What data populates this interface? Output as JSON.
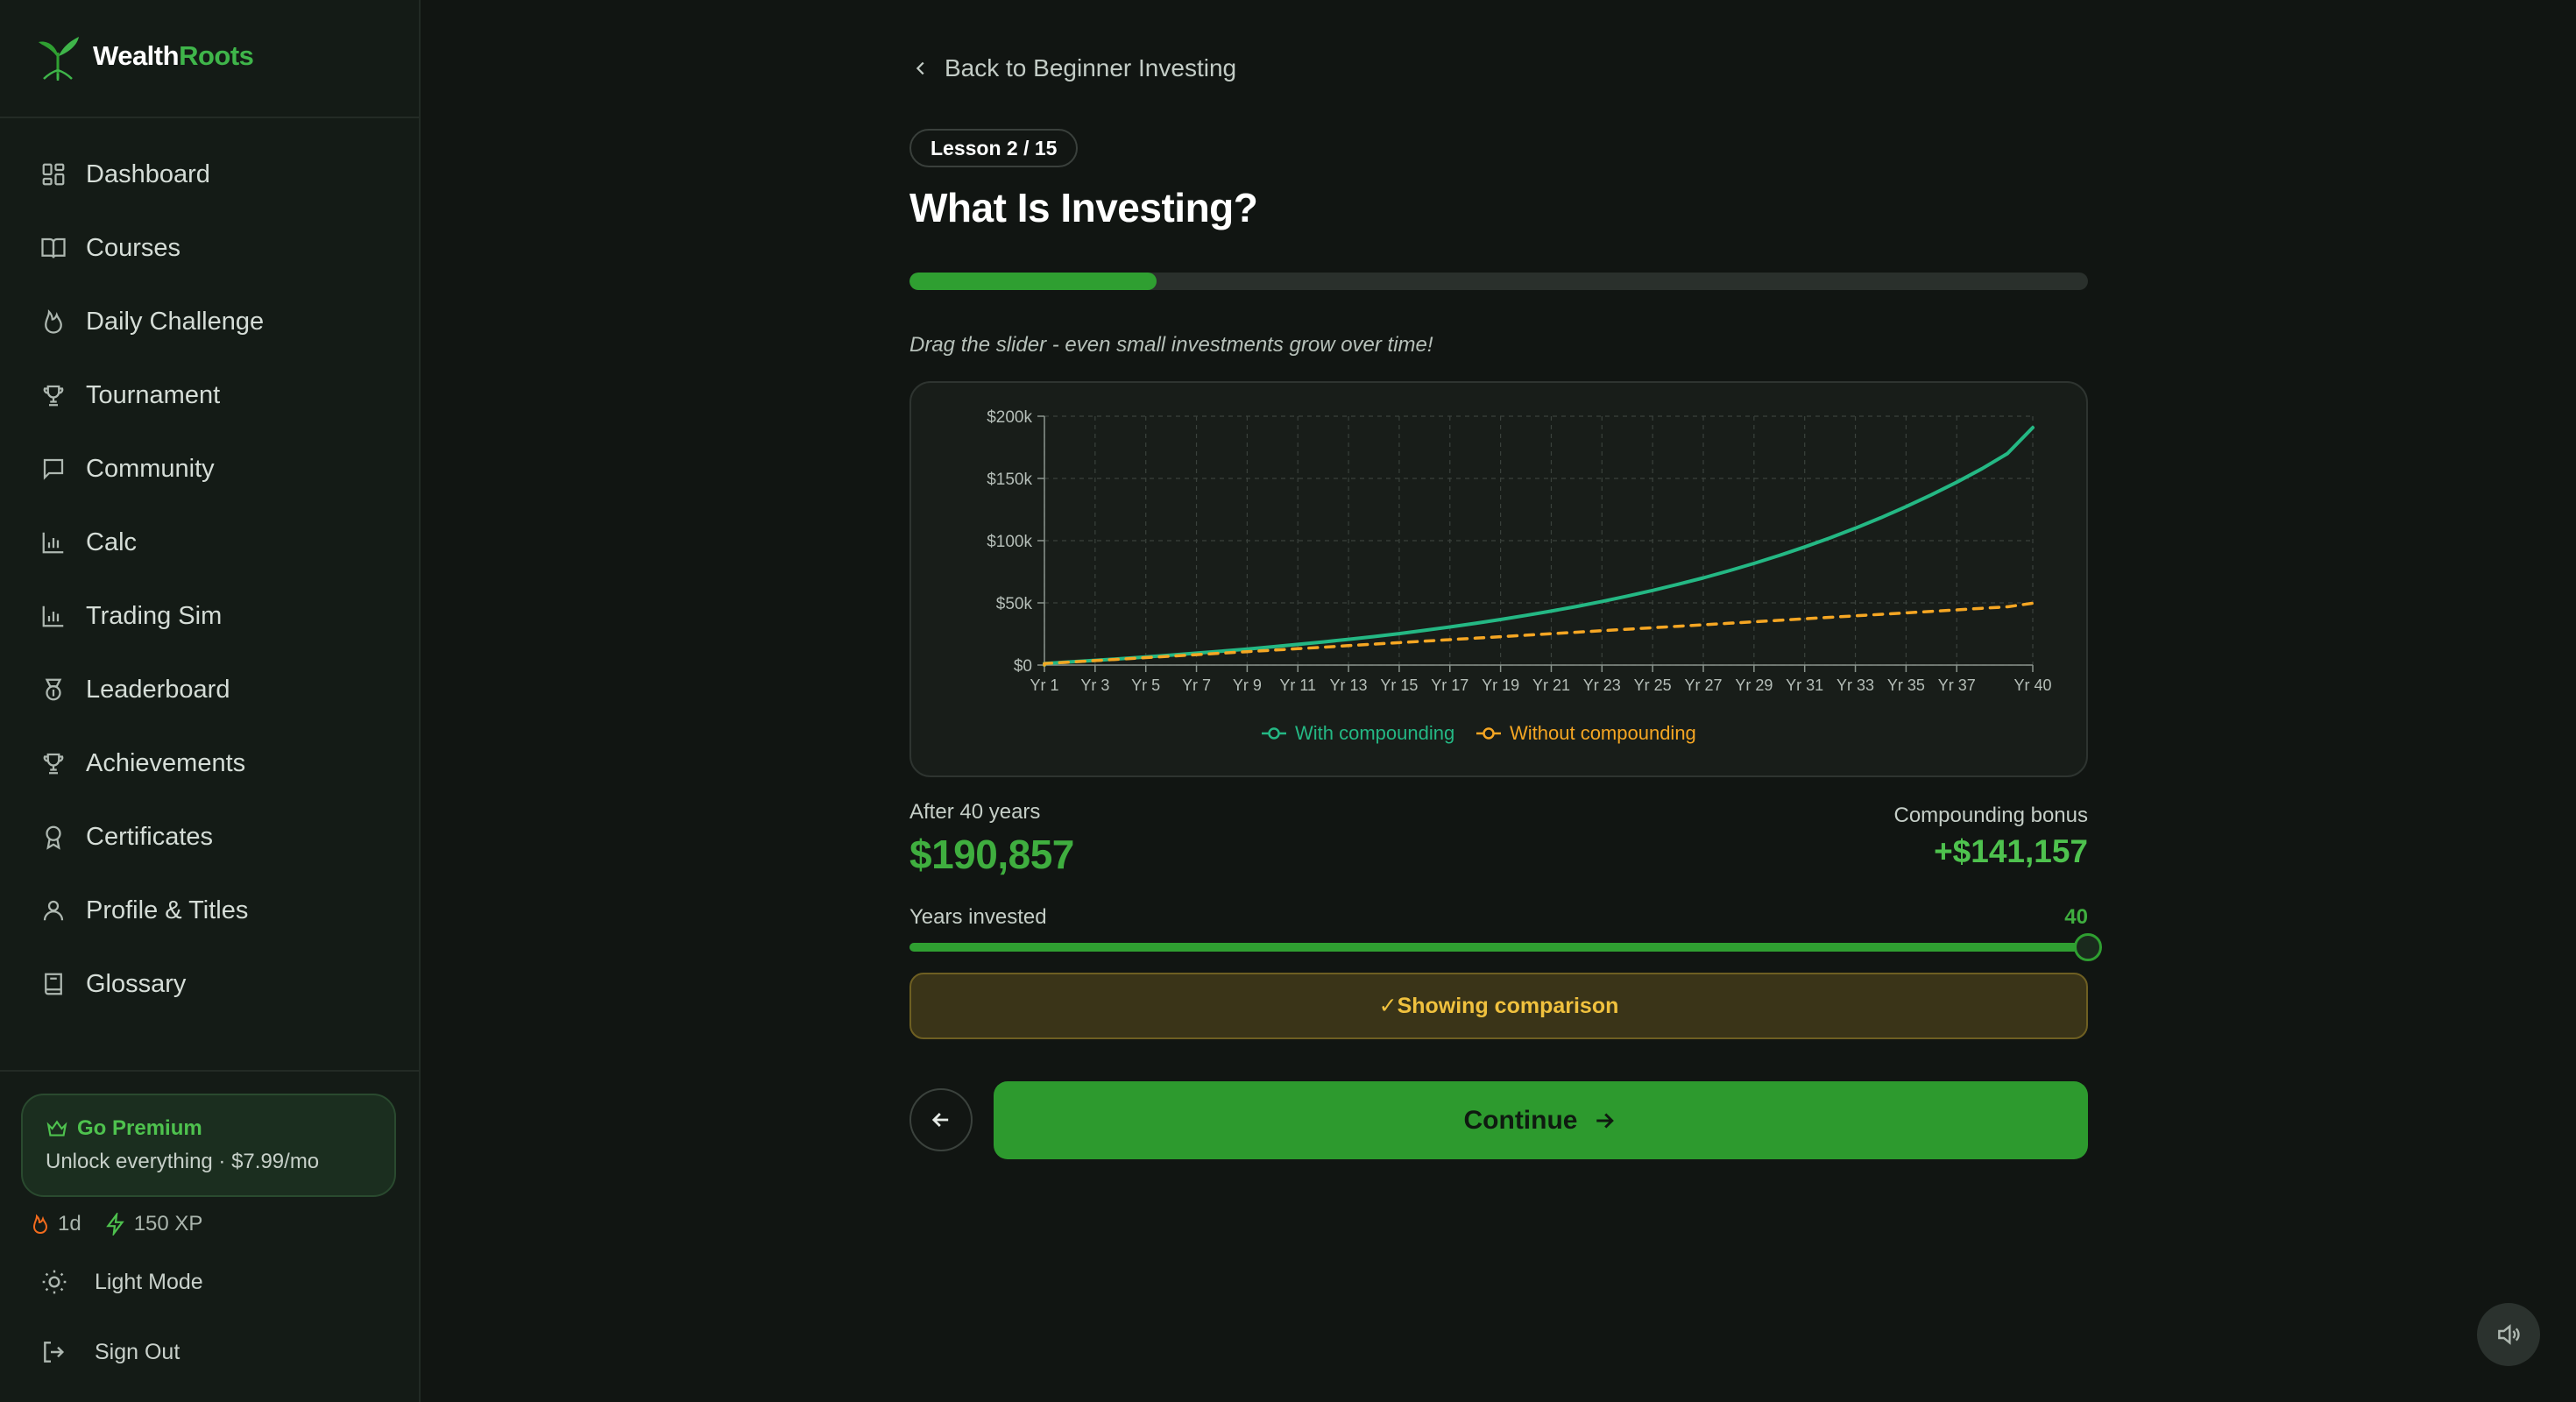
{
  "brand": {
    "name_part1": "Wealth",
    "name_part2": "Roots",
    "logo_icon": "sprout-icon"
  },
  "sidebar": {
    "items": [
      {
        "label": "Dashboard",
        "icon": "dashboard-grid-icon"
      },
      {
        "label": "Courses",
        "icon": "book-open-icon"
      },
      {
        "label": "Daily Challenge",
        "icon": "flame-icon"
      },
      {
        "label": "Tournament",
        "icon": "trophy-icon"
      },
      {
        "label": "Community",
        "icon": "message-square-icon"
      },
      {
        "label": "Calc",
        "icon": "bar-chart-icon"
      },
      {
        "label": "Trading Sim",
        "icon": "bar-chart-icon"
      },
      {
        "label": "Leaderboard",
        "icon": "medal-icon"
      },
      {
        "label": "Achievements",
        "icon": "trophy-icon"
      },
      {
        "label": "Certificates",
        "icon": "award-icon"
      },
      {
        "label": "Profile & Titles",
        "icon": "user-icon"
      },
      {
        "label": "Glossary",
        "icon": "book-icon"
      }
    ],
    "premium": {
      "title": "Go Premium",
      "subtitle": "Unlock everything · $7.99/mo"
    },
    "stats": {
      "streak": "1d",
      "xp": "150 XP"
    },
    "light_mode": "Light Mode",
    "sign_out": "Sign Out"
  },
  "lesson": {
    "back_label": "Back to Beginner Investing",
    "badge": "Lesson 2 / 15",
    "title": "What Is Investing?",
    "progress": 0.21,
    "hint": "Drag the slider - even small investments grow over time!"
  },
  "results": {
    "after_label": "After 40 years",
    "after_value": "$190,857",
    "bonus_label": "Compounding bonus",
    "bonus_value": "+$141,157",
    "years_label": "Years invested",
    "years_value": "40",
    "years_fraction": 1.0
  },
  "comparison_button": "✓Showing comparison",
  "continue_label": "Continue",
  "colors": {
    "accent_green": "#2d9a2e",
    "compounding_line": "#24b884",
    "no_compounding_line": "#f5a623",
    "comparison_gold": "#f0c13e"
  },
  "chart_data": {
    "type": "line",
    "x": [
      1,
      2,
      3,
      4,
      5,
      6,
      7,
      8,
      9,
      10,
      11,
      12,
      13,
      14,
      15,
      16,
      17,
      18,
      19,
      20,
      21,
      22,
      23,
      24,
      25,
      26,
      27,
      28,
      29,
      30,
      31,
      32,
      33,
      34,
      35,
      36,
      37,
      38,
      39,
      40
    ],
    "x_tick_labels": [
      "Yr 1",
      "Yr 3",
      "Yr 5",
      "Yr 7",
      "Yr 9",
      "Yr 11",
      "Yr 13",
      "Yr 15",
      "Yr 17",
      "Yr 19",
      "Yr 21",
      "Yr 23",
      "Yr 25",
      "Yr 27",
      "Yr 29",
      "Yr 31",
      "Yr 33",
      "Yr 35",
      "Yr 37",
      "Yr 40"
    ],
    "y_tick_labels": [
      "$0",
      "$50k",
      "$100k",
      "$150k",
      "$200k"
    ],
    "ylim": [
      0,
      200000
    ],
    "grid": true,
    "legend_position": "bottom",
    "series": [
      {
        "name": "With compounding",
        "style": "solid",
        "values": [
          1200,
          2500,
          3800,
          5100,
          6500,
          8000,
          9600,
          11200,
          12900,
          14700,
          16600,
          18600,
          20700,
          22900,
          25300,
          27900,
          30600,
          33500,
          36600,
          39900,
          43400,
          47100,
          51100,
          55400,
          60000,
          64900,
          70100,
          75700,
          81700,
          88100,
          94900,
          102200,
          110000,
          118400,
          127300,
          136800,
          147000,
          157900,
          170000,
          190857
        ]
      },
      {
        "name": "Without compounding",
        "style": "dashed",
        "values": [
          1200,
          2400,
          3600,
          4800,
          6000,
          7200,
          8400,
          9600,
          10800,
          12000,
          13200,
          14400,
          15600,
          16800,
          18000,
          19200,
          20400,
          21600,
          22800,
          24000,
          25200,
          26400,
          27600,
          28800,
          30000,
          31200,
          32400,
          33600,
          34800,
          36000,
          37200,
          38400,
          39600,
          40800,
          42000,
          43200,
          44400,
          45600,
          46800,
          49700
        ]
      }
    ]
  }
}
